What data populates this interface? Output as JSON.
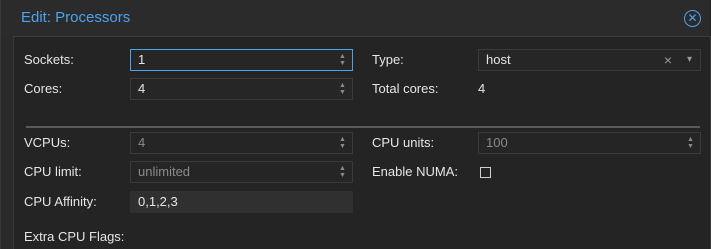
{
  "background": {
    "glyph": ")"
  },
  "dialog": {
    "title": "Edit: Processors",
    "close_icon": "close-circle-icon"
  },
  "form": {
    "sockets": {
      "label": "Sockets:",
      "value": "1"
    },
    "cores": {
      "label": "Cores:",
      "value": "4"
    },
    "type": {
      "label": "Type:",
      "value": "host"
    },
    "total_cores": {
      "label": "Total cores:",
      "value": "4"
    },
    "vcpus": {
      "label": "VCPUs:",
      "value": "4"
    },
    "cpu_units": {
      "label": "CPU units:",
      "value": "100"
    },
    "cpu_limit": {
      "label": "CPU limit:",
      "value": "unlimited"
    },
    "enable_numa": {
      "label": "Enable NUMA:",
      "checked": false
    },
    "cpu_affinity": {
      "label": "CPU Affinity:",
      "value": "0,1,2,3"
    },
    "extra_cpu_flags": {
      "label": "Extra CPU Flags:"
    }
  },
  "colors": {
    "accent": "#4aa3ef",
    "panel": "#242424",
    "header": "#2b2b2b"
  }
}
